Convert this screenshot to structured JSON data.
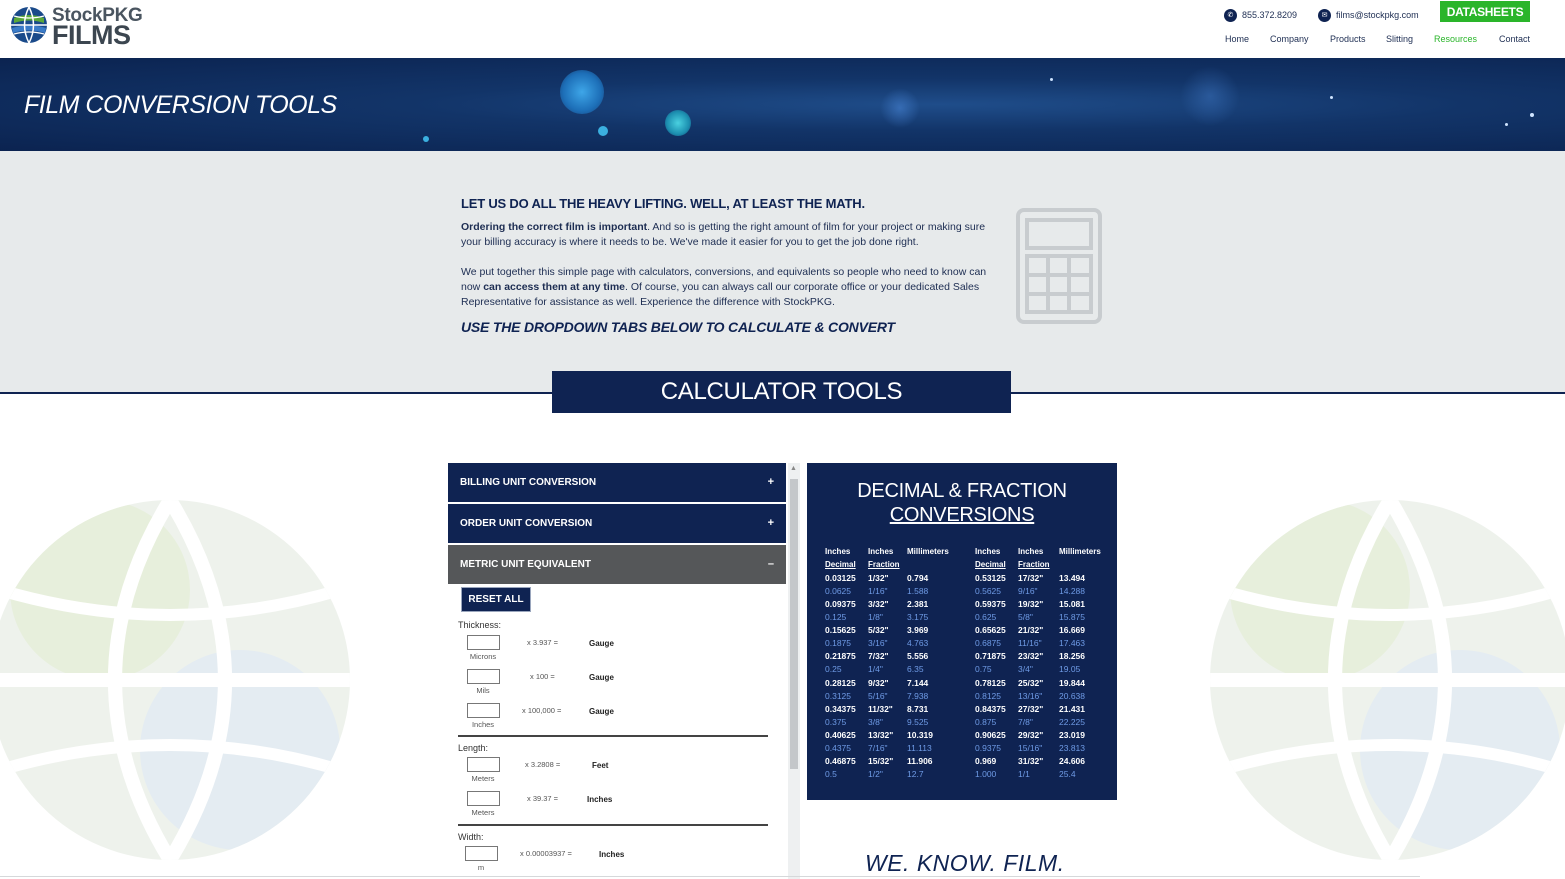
{
  "header": {
    "logo_line1": "StockPKG",
    "logo_line2": "FILMS",
    "phone": "855.372.8209",
    "email": "films@stockpkg.com",
    "datasheets": "DATASHEETS",
    "nav": [
      "Home",
      "Company",
      "Products",
      "Slitting",
      "Resources",
      "Contact"
    ],
    "nav_active": "Resources"
  },
  "banner": {
    "title": "FILM CONVERSION TOOLS"
  },
  "intro": {
    "heading": "LET US DO ALL THE HEAVY LIFTING.  WELL, AT LEAST THE MATH.",
    "p1_bold": "Ordering the correct film is important",
    "p1_rest": ". And so is getting the right amount of film for your project or making sure your billing accuracy is where it needs to be. We've made it easier for you to get the job done right.",
    "p2_a": "We put together this simple page with calculators, conversions, and equivalents so people who need to know can now ",
    "p2_bold": "can access them at any time",
    "p2_b": ". Of course, you can always call our corporate office or your dedicated Sales Representative for assistance as well. Experience the difference with StockPKG.",
    "cta": "USE THE DROPDOWN TABS BELOW TO CALCULATE & CONVERT",
    "calculator_icon": "calculator-icon"
  },
  "calculator_tools": {
    "title": "CALCULATOR TOOLS"
  },
  "accordion": {
    "items": [
      {
        "label": "BILLING UNIT CONVERSION",
        "sign": "+"
      },
      {
        "label": "ORDER UNIT CONVERSION",
        "sign": "+"
      },
      {
        "label": "METRIC UNIT EQUIVALENT",
        "sign": "–"
      }
    ],
    "reset": "RESET ALL",
    "thickness_label": "Thickness:",
    "thickness": [
      {
        "cap": "Microns",
        "mult": "x 3.937 =",
        "unit": "Gauge"
      },
      {
        "cap": "Mils",
        "mult": "x 100 =",
        "unit": "Gauge"
      },
      {
        "cap": "Inches",
        "mult": "x 100,000 =",
        "unit": "Gauge"
      }
    ],
    "length_label": "Length:",
    "length": [
      {
        "cap": "Meters",
        "mult": "x 3.2808 =",
        "unit": "Feet"
      },
      {
        "cap": "Meters",
        "mult": "x 39.37 =",
        "unit": "Inches"
      }
    ],
    "width_label": "Width:",
    "width": [
      {
        "cap": "m",
        "mult": "x 0.00003937 =",
        "unit": "Inches"
      }
    ]
  },
  "decimal_table": {
    "title1": "DECIMAL & FRACTION",
    "title2": "CONVERSIONS",
    "head_top": [
      "Inches",
      "Inches",
      "Millimeters",
      "Inches",
      "Inches",
      "Millimeters"
    ],
    "head_sub": [
      "Decimal",
      "Fraction",
      "",
      "Decimal",
      "Fraction",
      ""
    ],
    "rows": [
      [
        "0.03125",
        "1/32\"",
        "0.794",
        "0.53125",
        "17/32\"",
        "13.494"
      ],
      [
        "0.0625",
        "1/16\"",
        "1.588",
        "0.5625",
        "9/16\"",
        "14.288"
      ],
      [
        "0.09375",
        "3/32\"",
        "2.381",
        "0.59375",
        "19/32\"",
        "15.081"
      ],
      [
        "0.125",
        "1/8\"",
        "3.175",
        "0.625",
        "5/8\"",
        "15.875"
      ],
      [
        "0.15625",
        "5/32\"",
        "3.969",
        "0.65625",
        "21/32\"",
        "16.669"
      ],
      [
        "0.1875",
        "3/16\"",
        "4.763",
        "0.6875",
        "11/16\"",
        "17.463"
      ],
      [
        "0.21875",
        "7/32\"",
        "5.556",
        "0.71875",
        "23/32\"",
        "18.256"
      ],
      [
        "0.25",
        "1/4\"",
        "6.35",
        "0.75",
        "3/4\"",
        "19.05"
      ],
      [
        "0.28125",
        "9/32\"",
        "7.144",
        "0.78125",
        "25/32\"",
        "19.844"
      ],
      [
        "0.3125",
        "5/16\"",
        "7.938",
        "0.8125",
        "13/16\"",
        "20.638"
      ],
      [
        "0.34375",
        "11/32\"",
        "8.731",
        "0.84375",
        "27/32\"",
        "21.431"
      ],
      [
        "0.375",
        "3/8\"",
        "9.525",
        "0.875",
        "7/8\"",
        "22.225"
      ],
      [
        "0.40625",
        "13/32\"",
        "10.319",
        "0.90625",
        "29/32\"",
        "23.019"
      ],
      [
        "0.4375",
        "7/16\"",
        "11.113",
        "0.9375",
        "15/16\"",
        "23.813"
      ],
      [
        "0.46875",
        "15/32\"",
        "11.906",
        "0.969",
        "31/32\"",
        "24.606"
      ],
      [
        "0.5",
        "1/2\"",
        "12.7",
        "1.000",
        "1/1",
        "25.4"
      ]
    ]
  },
  "tagline": "WE. KNOW. FILM.",
  "colors": {
    "navy": "#0f2352",
    "green": "#2ab52a",
    "accordion_open": "#555759",
    "table_alt": "#6f9be6"
  }
}
